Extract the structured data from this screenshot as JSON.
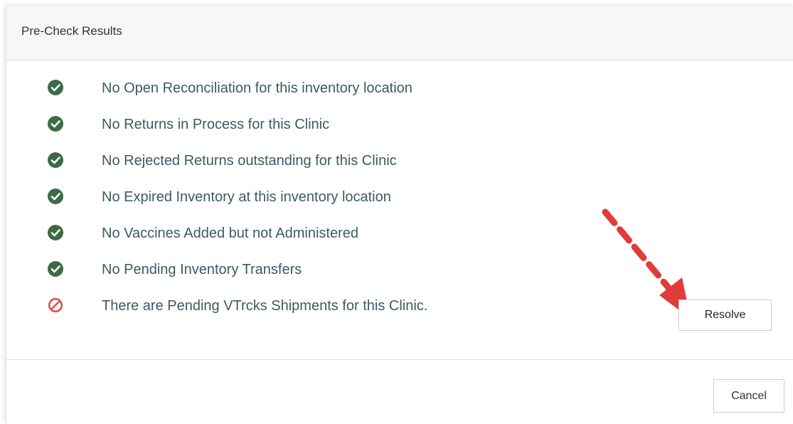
{
  "dialog": {
    "title": "Pre-Check Results"
  },
  "results": [
    {
      "status": "pass",
      "icon": "check-circle-icon",
      "text": "No Open Reconciliation for this inventory location"
    },
    {
      "status": "pass",
      "icon": "check-circle-icon",
      "text": "No Returns in Process for this Clinic"
    },
    {
      "status": "pass",
      "icon": "check-circle-icon",
      "text": "No Rejected Returns outstanding for this Clinic"
    },
    {
      "status": "pass",
      "icon": "check-circle-icon",
      "text": "No Expired Inventory at this inventory location"
    },
    {
      "status": "pass",
      "icon": "check-circle-icon",
      "text": "No Vaccines Added but not Administered"
    },
    {
      "status": "pass",
      "icon": "check-circle-icon",
      "text": "No Pending Inventory Transfers"
    },
    {
      "status": "fail",
      "icon": "prohibited-icon",
      "text": "There are Pending VTrcks Shipments for this Clinic."
    }
  ],
  "actions": {
    "resolve_label": "Resolve",
    "cancel_label": "Cancel"
  },
  "colors": {
    "pass": "#3e6b45",
    "fail": "#d9534f",
    "text": "#3b5a66",
    "annotation_arrow": "#e23b3b"
  }
}
